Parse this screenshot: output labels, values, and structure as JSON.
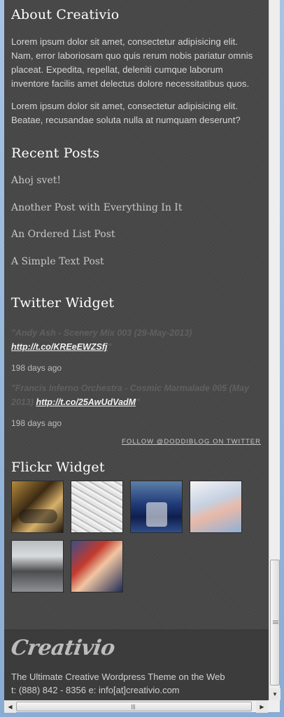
{
  "about": {
    "title": "About Creativio",
    "paragraph1": "Lorem ipsum dolor sit amet, consectetur adipisicing elit. Nam, error laboriosam quo quis rerum nobis pariatur omnis placeat. Expedita, repellat, deleniti cumque laborum inventore facilis amet delectus dolore necessitatibus quos.",
    "paragraph2": "Lorem ipsum dolor sit amet, consectetur adipisicing elit. Beatae, recusandae soluta nulla at numquam deserunt?"
  },
  "recent_posts": {
    "title": "Recent Posts",
    "items": [
      "Ahoj svet!",
      "Another Post with Everything In It",
      "An Ordered List Post",
      "A Simple Text Post"
    ]
  },
  "twitter": {
    "title": "Twitter Widget",
    "tweets": [
      {
        "quote": "\"Andy Ash - Scenery Mix 003 (29-May-2013)",
        "link": "http://t.co/KREeEWZSfj",
        "quote_end": "\"",
        "time": "198 days ago"
      },
      {
        "quote": "\"Francis Inferno Orchestra - Cosmic Marmalade 005 (May 2013)",
        "link": "http://t.co/25AwUdVadM",
        "quote_end": "\"",
        "time": "198 days ago"
      }
    ],
    "follow": "FOLLOW @DODDIBLOG ON TWITTER"
  },
  "flickr": {
    "title": "Flickr Widget"
  },
  "footer": {
    "logo": "Creativio",
    "tagline": "The Ultimate Creative Wordpress Theme on the Web",
    "contact": "t: (888) 842 - 8356 e: info[at]creativio.com"
  },
  "colors": {
    "background": "#474747",
    "footer_background": "#3c3c3c",
    "heading": "#ffffff",
    "window_frame": "#a7c4e4"
  }
}
